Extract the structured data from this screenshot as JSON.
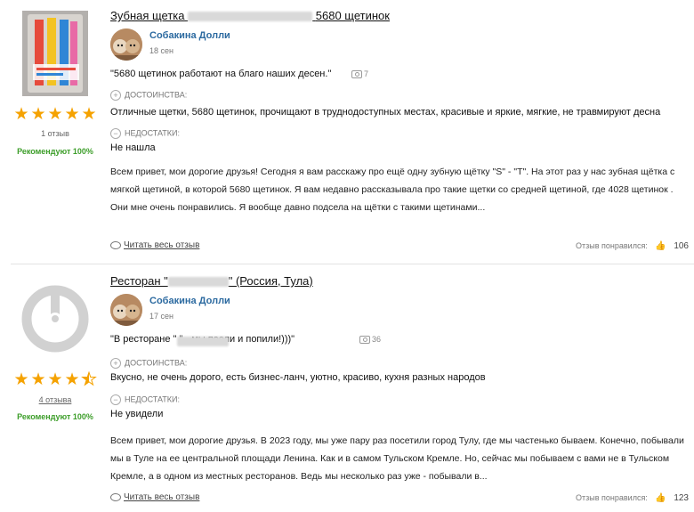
{
  "reviews": [
    {
      "title_pre": "Зубная щетка",
      "title_post": "5680 щетинок",
      "stars": 5,
      "reviews_count": "1 отзыв",
      "recommend": "Рекомендуют 100%",
      "author": "Собакина Долли",
      "date": "18 сен",
      "quote": "\"5680 щетинок работают на благо наших десен.\"",
      "photos": "7",
      "pros_label": "ДОСТОИНСТВА:",
      "pros": "Отличные щетки, 5680 щетинок, прочищают в труднодоступных местах, красивые и яркие, мягкие, не травмируют десна",
      "cons_label": "НЕДОСТАТКИ:",
      "cons": "Не нашла",
      "body": "Всем привет, мои дорогие друзья! Сегодня я вам расскажу про ещё одну зубную щётку \"S\" - \"T\". На этот раз у нас зубная щётка с мягкой щетиной, в которой 5680 щетинок. Я вам недавно рассказывала про такие щетки со средней щетиной, где 4028 щетинок . Они мне очень понравились. Я вообще давно подсела на щётки с такими щетинами...",
      "read_more": "Читать весь отзыв",
      "liked_label": "Отзыв понравился:",
      "likes": "106"
    },
    {
      "title_pre": "Ресторан \"",
      "title_post": "\" (Россия, Тула)",
      "stars": 4.5,
      "reviews_count": "4 отзыва",
      "recommend": "Рекомендуют 100%",
      "author": "Собакина Долли",
      "date": "17 сен",
      "quote": "\"В ресторане \"                    \" - мы поели и попили!)))\"",
      "photos": "36",
      "pros_label": "ДОСТОИНСТВА:",
      "pros": "Вкусно, не очень дорого, есть бизнес-ланч, уютно, красиво, кухня разных народов",
      "cons_label": "НЕДОСТАТКИ:",
      "cons": "Не увидели",
      "body": "Всем привет, мои дорогие друзья. В 2023 году, мы уже пару раз посетили город Тулу, где мы частенько бываем. Конечно, побывали мы в Туле на ее центральной площади Ленина. Как и в самом Тульском Кремле. Но, сейчас мы побываем с вами не в Тульском Кремле, а в одном из местных ресторанов. Ведь мы несколько раз уже - побывали в...",
      "read_more": "Читать весь отзыв",
      "liked_label": "Отзыв понравился:",
      "likes": "123"
    }
  ],
  "colors": {
    "star": "#f5a200",
    "author": "#2c6aa0",
    "recommend": "#3d9e2a"
  },
  "icons": {
    "pros": "plus-circle-icon",
    "cons": "minus-circle-icon",
    "camera": "camera-icon",
    "eye": "eye-icon",
    "thumb": "thumbs-up-icon"
  }
}
